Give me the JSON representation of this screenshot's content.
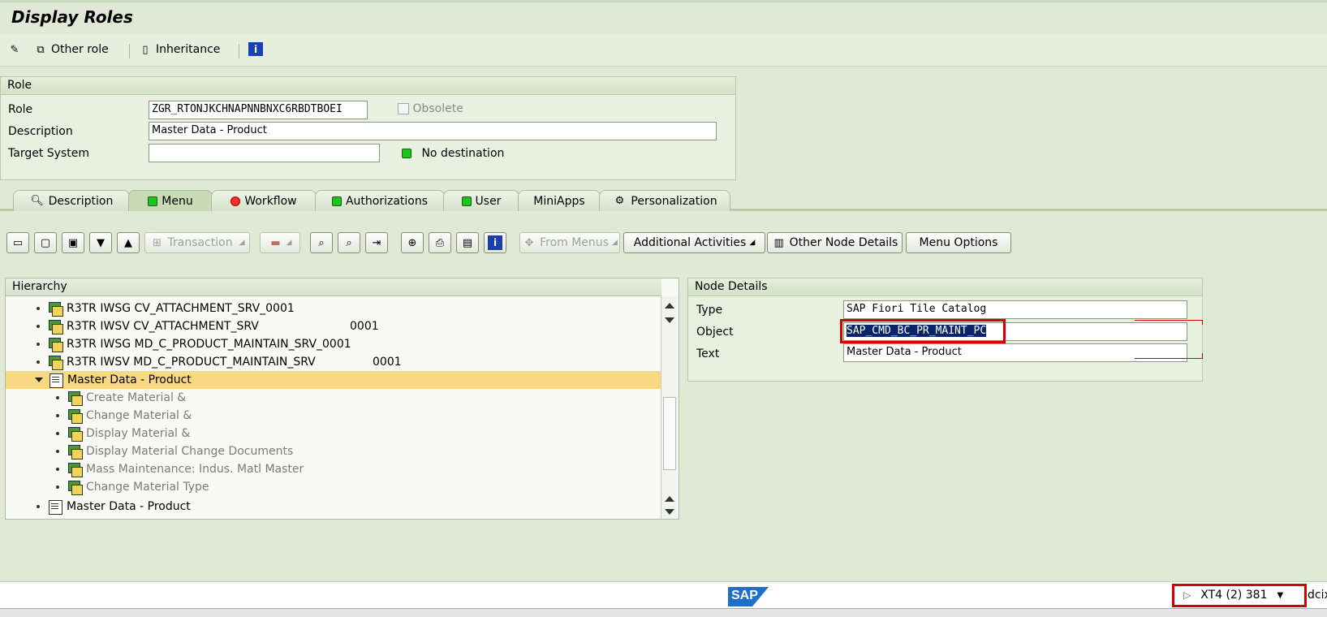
{
  "window": {
    "title": "Display Roles"
  },
  "app_toolbar": {
    "other_role": "Other role",
    "inheritance": "Inheritance"
  },
  "role_box": {
    "header": "Role",
    "role_label": "Role",
    "role_value": "ZGR_RTONJKCHNAPNNBNXC6RBDTBOEI",
    "obsolete_label": "Obsolete",
    "description_label": "Description",
    "description_value": "Master Data - Product",
    "target_system_label": "Target System",
    "target_system_value": "",
    "destination_status": "No destination"
  },
  "tabs": [
    {
      "label": "Description"
    },
    {
      "label": "Menu"
    },
    {
      "label": "Workflow"
    },
    {
      "label": "Authorizations"
    },
    {
      "label": "User"
    },
    {
      "label": "MiniApps"
    },
    {
      "label": "Personalization"
    }
  ],
  "menu_toolbar": {
    "transaction": "Transaction",
    "from_menus": "From Menus",
    "additional_activities": "Additional Activities",
    "other_node_details": "Other Node Details",
    "menu_options": "Menu Options"
  },
  "hierarchy": {
    "header": "Hierarchy",
    "rows": [
      {
        "text": "R3TR IWSG CV_ATTACHMENT_SRV_0001",
        "suffix": ""
      },
      {
        "text": "R3TR IWSV CV_ATTACHMENT_SRV",
        "suffix": "0001"
      },
      {
        "text": "R3TR IWSG MD_C_PRODUCT_MAINTAIN_SRV_0001",
        "suffix": ""
      },
      {
        "text": "R3TR IWSV MD_C_PRODUCT_MAINTAIN_SRV",
        "suffix": "0001"
      },
      {
        "text": "Master Data - Product",
        "suffix": ""
      },
      {
        "text": "Create Material &",
        "suffix": ""
      },
      {
        "text": "Change Material &",
        "suffix": ""
      },
      {
        "text": "Display Material &",
        "suffix": ""
      },
      {
        "text": "Display Material Change Documents",
        "suffix": ""
      },
      {
        "text": "Mass Maintenance: Indus. Matl Master",
        "suffix": ""
      },
      {
        "text": "Change Material Type",
        "suffix": ""
      },
      {
        "text": "Master Data - Product",
        "suffix": ""
      }
    ]
  },
  "node_details": {
    "header": "Node Details",
    "type_label": "Type",
    "type_value": "SAP Fiori Tile Catalog",
    "object_label": "Object",
    "object_value": "SAP_CMD_BC_PR_MAINT_PC",
    "text_label": "Text",
    "text_value": "Master Data - Product"
  },
  "status_bar": {
    "logo": "SAP",
    "system": "XT4 (2) 381",
    "host": "dcix"
  }
}
